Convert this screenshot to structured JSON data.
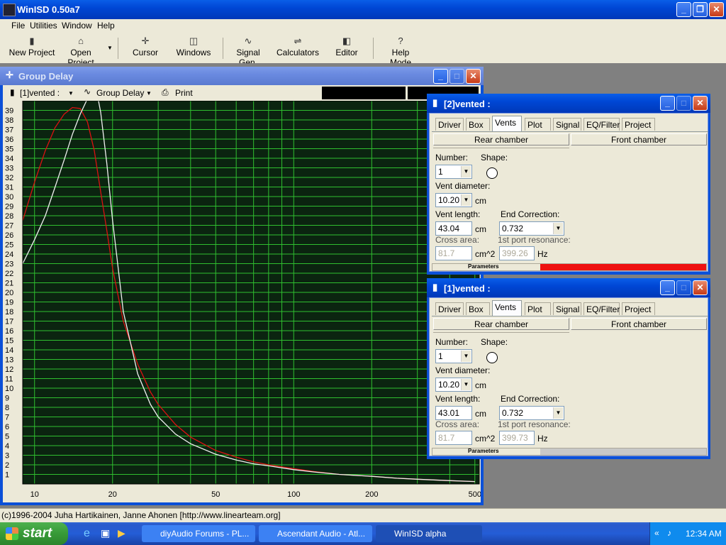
{
  "app": {
    "title": "WinISD 0.50a7"
  },
  "menu": [
    "File",
    "Utilities",
    "Window",
    "Help"
  ],
  "toolbar": [
    {
      "label": "New Project",
      "icon": "new-project-icon"
    },
    {
      "label": "Open Project",
      "icon": "open-project-icon"
    },
    {
      "label": "Cursor",
      "icon": "cursor-icon"
    },
    {
      "label": "Windows",
      "icon": "windows-icon"
    },
    {
      "label": "Signal Gen.",
      "icon": "signal-gen-icon"
    },
    {
      "label": "Calculators",
      "icon": "calculators-icon"
    },
    {
      "label": "Editor",
      "icon": "editor-icon"
    },
    {
      "label": "Help Mode",
      "icon": "help-icon"
    }
  ],
  "group_delay": {
    "title": "Group Delay",
    "project_select": "[1]vented :",
    "plot_select": "Group Delay",
    "print_label": "Print"
  },
  "vents_windows": [
    {
      "title": "[2]vented :",
      "tabs": [
        "Driver",
        "Box",
        "Vents",
        "Plot",
        "Signal",
        "EQ/Filter",
        "Project"
      ],
      "active_tab": "Vents",
      "rear_chamber": "Rear chamber",
      "front_chamber": "Front chamber",
      "number_label": "Number:",
      "number": "1",
      "shape_label": "Shape:",
      "vent_diameter_label": "Vent diameter:",
      "vent_diameter": "10.20",
      "diameter_unit": "cm",
      "vent_length_label": "Vent length:",
      "vent_length": "43.04",
      "length_unit": "cm",
      "end_correction_label": "End Correction:",
      "end_correction": "0.732",
      "cross_area_label": "Cross area:",
      "cross_area": "81.7",
      "area_unit": "cm^2",
      "port_resonance_label": "1st port resonance:",
      "port_resonance": "399.26",
      "resonance_unit": "Hz",
      "parameters_label": "Parameters",
      "status_color": "#ee1111"
    },
    {
      "title": "[1]vented :",
      "tabs": [
        "Driver",
        "Box",
        "Vents",
        "Plot",
        "Signal",
        "EQ/Filter",
        "Project"
      ],
      "active_tab": "Vents",
      "rear_chamber": "Rear chamber",
      "front_chamber": "Front chamber",
      "number_label": "Number:",
      "number": "1",
      "shape_label": "Shape:",
      "vent_diameter_label": "Vent diameter:",
      "vent_diameter": "10.20",
      "diameter_unit": "cm",
      "vent_length_label": "Vent length:",
      "vent_length": "43.01",
      "length_unit": "cm",
      "end_correction_label": "End Correction:",
      "end_correction": "0.732",
      "cross_area_label": "Cross area:",
      "cross_area": "81.7",
      "area_unit": "cm^2",
      "port_resonance_label": "1st port resonance:",
      "port_resonance": "399.73",
      "resonance_unit": "Hz",
      "parameters_label": "Parameters",
      "status_color": "#c8c8c8"
    }
  ],
  "status_bar": "(c)1996-2004 Juha Hartikainen, Janne Ahonen [http://www.linearteam.org]",
  "taskbar": {
    "start": "start",
    "tasks": [
      "diyAudio Forums - PL...",
      "Ascendant Audio - Atl...",
      "WinISD alpha"
    ],
    "clock": "12:34 AM"
  },
  "chart_data": {
    "type": "line",
    "x_scale": "log",
    "xlim": [
      9,
      520
    ],
    "ylim": [
      0,
      40
    ],
    "x_ticks": [
      10,
      20,
      50,
      100,
      200,
      500
    ],
    "y_ticks": [
      1,
      2,
      3,
      4,
      5,
      6,
      7,
      8,
      9,
      10,
      11,
      12,
      13,
      14,
      15,
      16,
      17,
      18,
      19,
      20,
      21,
      22,
      23,
      24,
      25,
      26,
      27,
      28,
      29,
      30,
      31,
      32,
      33,
      34,
      35,
      36,
      37,
      38,
      39
    ],
    "grid": true,
    "series": [
      {
        "color": "#dd1111",
        "x": [
          9,
          10,
          11,
          12,
          13,
          14,
          15,
          16,
          17,
          18,
          19,
          20,
          22,
          25,
          28,
          30,
          35,
          40,
          50,
          60,
          70,
          80,
          100,
          120,
          150,
          200,
          250,
          300,
          400,
          500
        ],
        "y": [
          27.5,
          31.5,
          34.8,
          37.2,
          38.6,
          39.3,
          39.2,
          37.8,
          34.8,
          30.5,
          26.5,
          22.5,
          17.0,
          12.5,
          9.6,
          8.3,
          6.2,
          4.9,
          3.5,
          2.8,
          2.3,
          2.0,
          1.6,
          1.3,
          1.0,
          0.8,
          0.6,
          0.5,
          0.35,
          0.25
        ]
      },
      {
        "color": "#f0f0f0",
        "x": [
          9,
          10,
          11,
          12,
          13,
          14,
          15,
          16,
          17,
          17.5,
          18,
          19,
          20,
          22,
          25,
          28,
          30,
          35,
          40,
          50,
          60,
          70,
          80,
          100,
          120,
          150,
          200,
          250,
          300,
          400,
          500
        ],
        "y": [
          23,
          25.5,
          28,
          31,
          33.8,
          36.5,
          38.6,
          40.2,
          41,
          40.5,
          38.8,
          33.5,
          27.5,
          18.0,
          11.5,
          8.3,
          7.0,
          5.2,
          4.2,
          3.1,
          2.5,
          2.1,
          1.9,
          1.5,
          1.25,
          1.0,
          0.8,
          0.6,
          0.5,
          0.35,
          0.25
        ]
      }
    ]
  }
}
